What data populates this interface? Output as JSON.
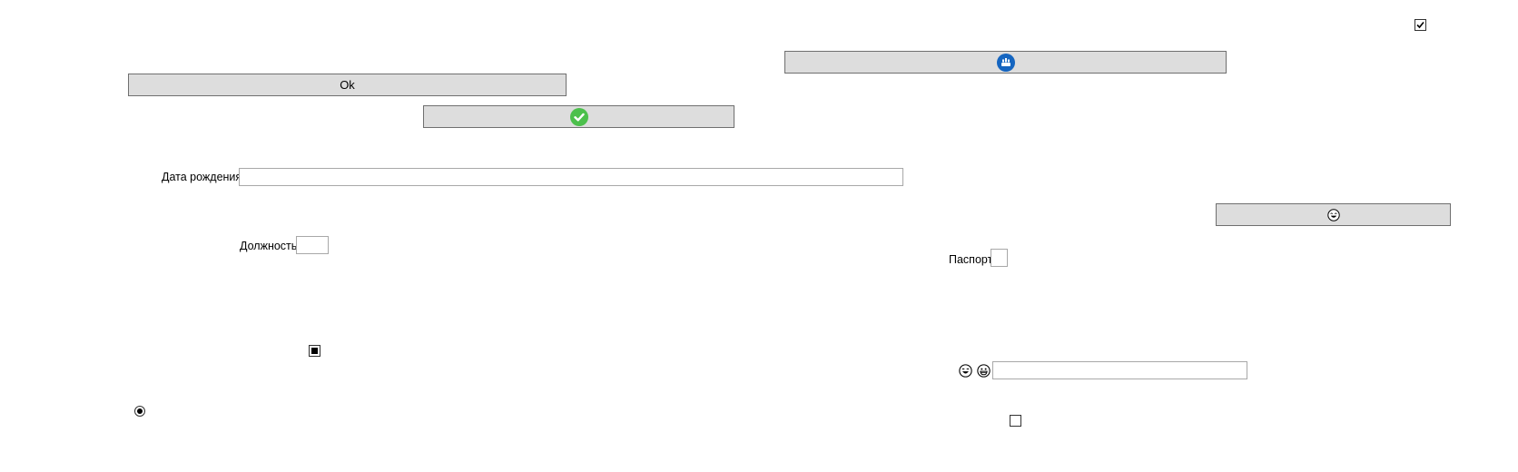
{
  "buttons": {
    "ok_label": "Ok",
    "check_button_icon": "green-check-circle-icon",
    "blue_button_icon": "blue-circle-logo-icon",
    "emoji_button_icon": "laughing-face-icon"
  },
  "fields": {
    "birth_date_label": "Дата рождения",
    "birth_date_value": "",
    "position_label": "Должность",
    "position_value": "",
    "passport_label": "Паспорт",
    "passport_value": "",
    "emoji_field_value": ""
  },
  "emoji_labels": [
    "laughing-face-icon",
    "grinning-face-icon"
  ],
  "controls": {
    "top_checkbox_checked": true,
    "bottom_checkbox_checked": false,
    "tristate_checkbox": "indeterminate",
    "radio_selected": true
  },
  "colors": {
    "button_bg": "#dddddd",
    "button_border": "#6f6f6f",
    "check_green": "#4cc04c",
    "logo_blue": "#1565c0"
  }
}
